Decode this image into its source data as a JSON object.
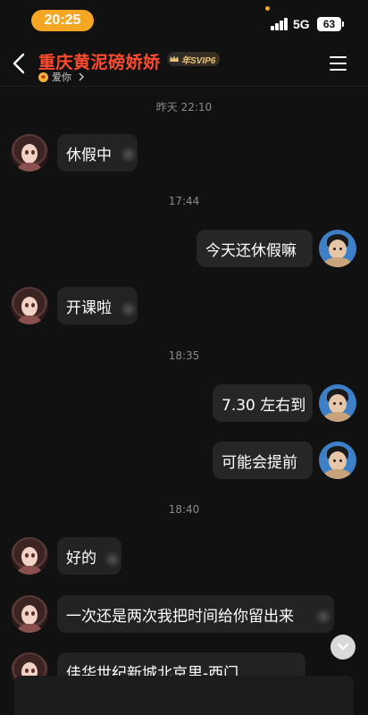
{
  "status_bar": {
    "time": "20:25",
    "network": "5G",
    "battery": "63"
  },
  "header": {
    "title": "重庆黄泥磅娇娇",
    "vip_badge": "年SVIP6",
    "subtitle": "爱你",
    "back_icon": "chevron-left-icon",
    "menu_icon": "menu-icon"
  },
  "messages": [
    {
      "type": "timestamp",
      "text": "昨天 22:10"
    },
    {
      "type": "message",
      "side": "left",
      "text": "休假中"
    },
    {
      "type": "timestamp",
      "text": "17:44"
    },
    {
      "type": "message",
      "side": "right",
      "text": "今天还休假嘛"
    },
    {
      "type": "message",
      "side": "left",
      "text": "开课啦"
    },
    {
      "type": "timestamp",
      "text": "18:35"
    },
    {
      "type": "message",
      "side": "right",
      "text": "7.30 左右到"
    },
    {
      "type": "message",
      "side": "right",
      "text": "可能会提前"
    },
    {
      "type": "timestamp",
      "text": "18:40"
    },
    {
      "type": "message",
      "side": "left",
      "text": "好的"
    },
    {
      "type": "message",
      "side": "left",
      "text": "一次还是两次我把时间给你留出来"
    },
    {
      "type": "message",
      "side": "left",
      "text": "佳华世纪新城北京里-西门"
    }
  ],
  "colors": {
    "accent": "#f6a623",
    "title": "#ff4b2f",
    "background": "#111111",
    "bubble": "#262626"
  }
}
